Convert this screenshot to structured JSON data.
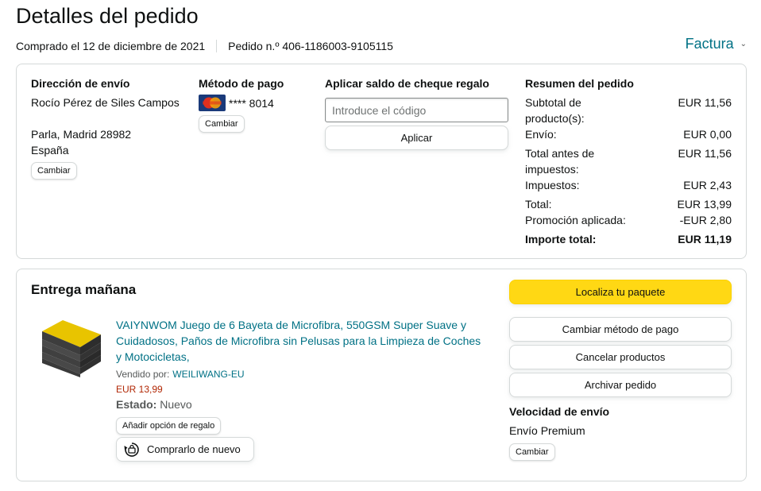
{
  "header": {
    "title": "Detalles del pedido",
    "purchase_date": "Comprado el 12 de diciembre de 2021",
    "order_number": "Pedido n.º 406-1186003-9105115",
    "invoice_label": "Factura"
  },
  "shipping": {
    "title": "Dirección de envío",
    "name": "Rocío Pérez de Siles Campos",
    "city": "Parla, Madrid 28982",
    "country": "España",
    "change_label": "Cambiar"
  },
  "payment": {
    "title": "Método de pago",
    "card_masked": "**** 8014",
    "change_label": "Cambiar",
    "card_brand_icon": "mastercard-icon"
  },
  "gift": {
    "title": "Aplicar saldo de cheque regalo",
    "placeholder": "Introduce el código",
    "apply_label": "Aplicar"
  },
  "summary": {
    "title": "Resumen del pedido",
    "subtotal_label_1": "Subtotal de",
    "subtotal_label_2": "producto(s):",
    "subtotal_value": "EUR 11,56",
    "shipping_label": "Envío:",
    "shipping_value": "EUR 0,00",
    "pretax_label_1": "Total antes de",
    "pretax_label_2": "impuestos:",
    "pretax_value": "EUR 11,56",
    "tax_label": "Impuestos:",
    "tax_value": "EUR 2,43",
    "total_label": "Total:",
    "total_value": "EUR 13,99",
    "promo_label": "Promoción aplicada:",
    "promo_value": "-EUR 2,80",
    "grand_label": "Importe total:",
    "grand_value": "EUR 11,19"
  },
  "delivery": {
    "title": "Entrega mañana",
    "product_title": "VAIYNWOM Juego de 6 Bayeta de Microfibra, 550GSM Super Suave y Cuidadosos, Paños de Microfibra sin Pelusas para la Limpieza de Coches y Motocicletas,",
    "sold_by_label": "Vendido por:",
    "seller": "WEILIWANG-EU",
    "price": "EUR 13,99",
    "condition_label": "Estado:",
    "condition_value": "Nuevo",
    "gift_option_label": "Añadir opción de regalo",
    "buy_again_label": "Comprarlo de nuevo",
    "track_label": "Localiza tu paquete",
    "change_payment_label": "Cambiar método de pago",
    "cancel_label": "Cancelar productos",
    "archive_label": "Archivar pedido",
    "speed_title": "Velocidad de envío",
    "speed_value": "Envío Premium",
    "speed_change_label": "Cambiar"
  },
  "colors": {
    "link": "#007185",
    "price": "#b12704",
    "primary_button": "#ffd814",
    "border": "#d5d9d9"
  }
}
